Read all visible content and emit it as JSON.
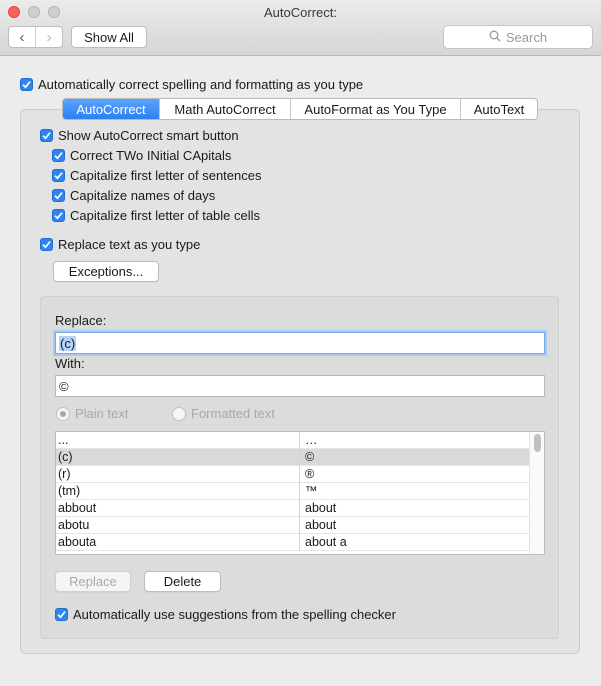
{
  "window": {
    "title": "AutoCorrect:"
  },
  "toolbar": {
    "back_glyph": "‹",
    "forward_glyph": "›",
    "show_all_label": "Show All",
    "search_placeholder": "Search"
  },
  "main": {
    "auto_correct_label": "Automatically correct spelling and formatting as you type",
    "tabs": [
      {
        "label": "AutoCorrect",
        "active": true
      },
      {
        "label": "Math AutoCorrect",
        "active": false
      },
      {
        "label": "AutoFormat as You Type",
        "active": false
      },
      {
        "label": "AutoText",
        "active": false
      }
    ],
    "options": {
      "show_smart_button": "Show AutoCorrect smart button",
      "correct_two_initial": "Correct TWo INitial CApitals",
      "capitalize_first_sentence": "Capitalize first letter of sentences",
      "capitalize_days": "Capitalize names of days",
      "capitalize_table_cells": "Capitalize first letter of table cells",
      "replace_text": "Replace text as you type"
    },
    "exceptions_label": "Exceptions...",
    "replace_label": "Replace:",
    "replace_value": "(c)",
    "with_label": "With:",
    "with_value": "©",
    "radio_plain": "Plain text",
    "radio_formatted": "Formatted text",
    "table_rows": [
      {
        "replace": "...",
        "with": "…"
      },
      {
        "replace": "(c)",
        "with": "©"
      },
      {
        "replace": "(r)",
        "with": "®"
      },
      {
        "replace": "(tm)",
        "with": "™"
      },
      {
        "replace": "abbout",
        "with": "about"
      },
      {
        "replace": "abotu",
        "with": "about"
      },
      {
        "replace": "abouta",
        "with": "about a"
      }
    ],
    "replace_button_label": "Replace",
    "delete_button_label": "Delete",
    "suggestions_label": "Automatically use suggestions from the spelling checker"
  },
  "colors": {
    "accent": "#2f84f0",
    "close_button": "#fc5f57"
  }
}
